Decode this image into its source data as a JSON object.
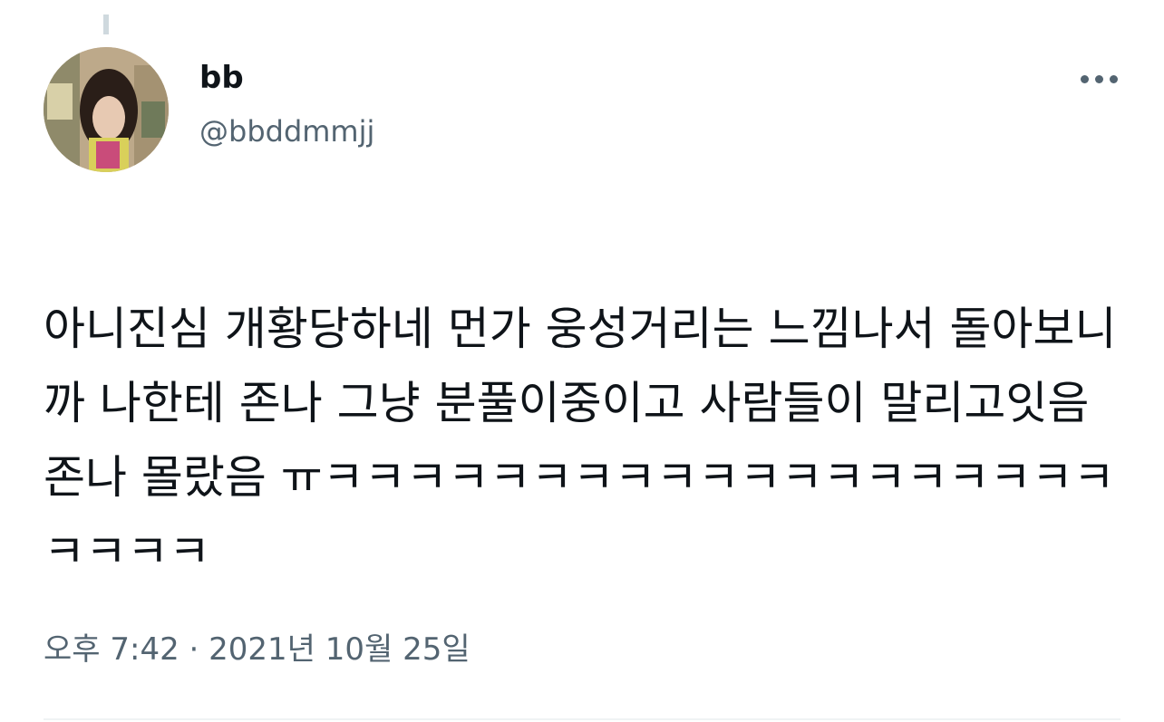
{
  "tweet": {
    "author": {
      "display_name": "bb",
      "handle": "@bbddmmjj"
    },
    "text": "아니진심 개황당하네 먼가 웅성거리는 느낌나서 돌아보니까 나한테 존나 그냥 분풀이중이고 사람들이 말리고잇음 존나 몰랐음 ㅠㅋㅋㅋㅋㅋㅋㅋㅋㅋㅋㅋㅋㅋㅋㅋㅋㅋㅋㅋㅋㅋㅋㅋ",
    "timestamp": "오후 7:42 · 2021년 10월 25일"
  },
  "icons": {
    "more": "more-horizontal-icon"
  },
  "colors": {
    "text_primary": "#0f1419",
    "text_secondary": "#536471",
    "divider": "#eff3f4",
    "thread_line": "#cfd9de"
  }
}
